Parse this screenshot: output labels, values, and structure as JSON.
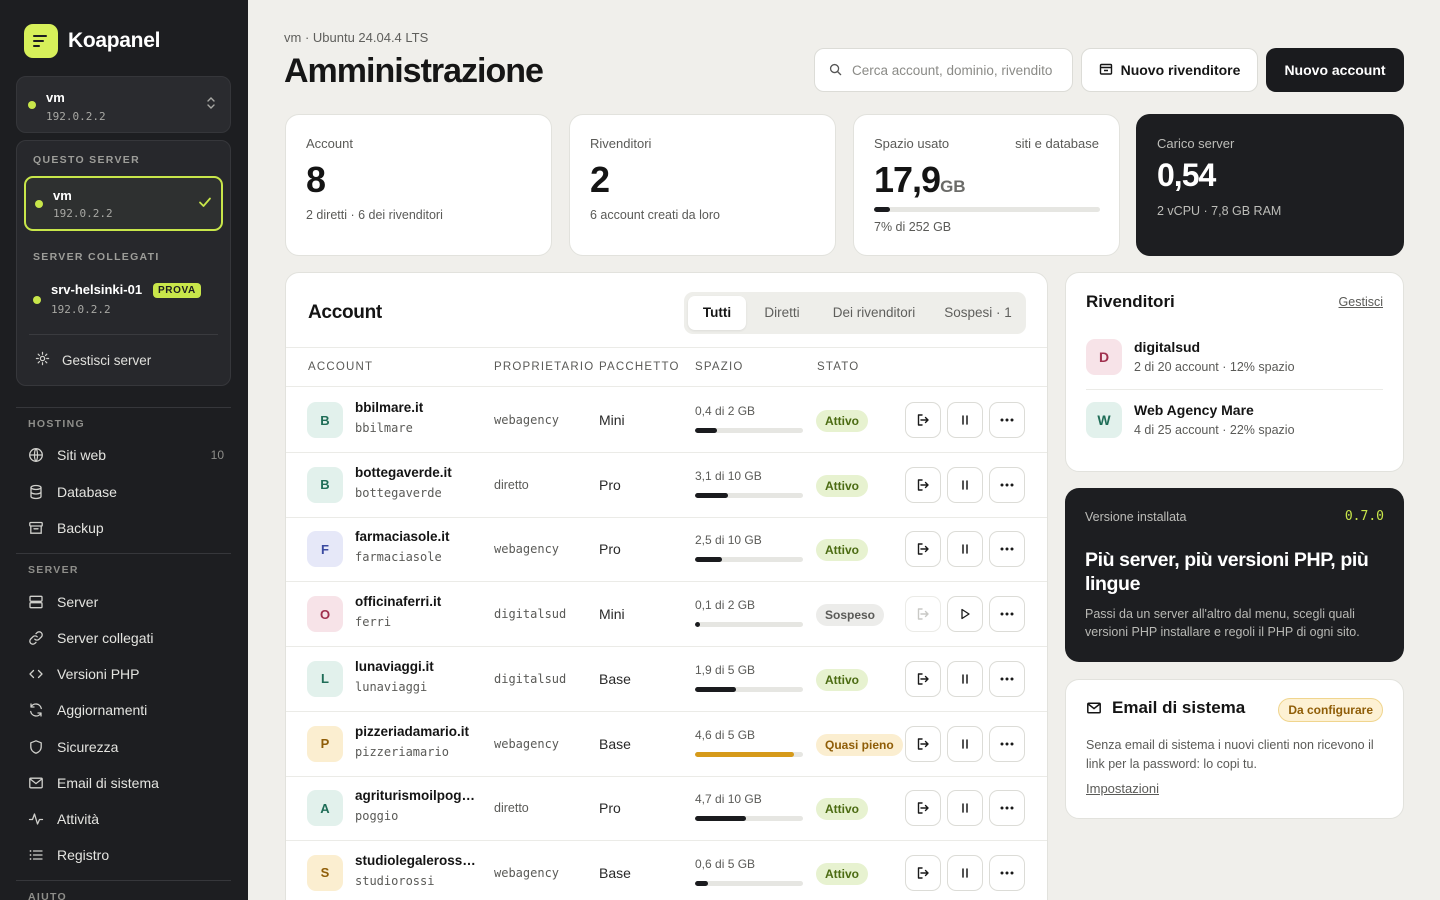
{
  "brand": {
    "name": "Koapanel",
    "accent": "#c8e64a"
  },
  "server_switcher": {
    "name": "vm",
    "ip": "192.0.2.2"
  },
  "dropdown": {
    "this_server_title": "QUESTO SERVER",
    "current": {
      "name": "vm",
      "ip": "192.0.2.2"
    },
    "linked_title": "SERVER COLLEGATI",
    "linked": {
      "name": "srv-helsinki-01",
      "badge": "PROVA",
      "ip": "192.0.2.2"
    },
    "manage_label": "Gestisci server"
  },
  "nav": {
    "hosting_title": "HOSTING",
    "hosting": [
      {
        "label": "Siti web",
        "count": "10",
        "icon": "globe-icon"
      },
      {
        "label": "Database",
        "icon": "database-icon"
      },
      {
        "label": "Backup",
        "icon": "archive-icon"
      }
    ],
    "server_title": "SERVER",
    "server": [
      {
        "label": "Server",
        "icon": "server-icon"
      },
      {
        "label": "Server collegati",
        "icon": "link-icon"
      },
      {
        "label": "Versioni PHP",
        "icon": "code-icon"
      },
      {
        "label": "Aggiornamenti",
        "icon": "refresh-icon"
      },
      {
        "label": "Sicurezza",
        "icon": "shield-icon"
      },
      {
        "label": "Email di sistema",
        "icon": "mail-icon"
      },
      {
        "label": "Attività",
        "icon": "activity-icon"
      },
      {
        "label": "Registro",
        "icon": "list-icon"
      }
    ],
    "help_title": "AIUTO"
  },
  "header": {
    "subtitle": "vm · Ubuntu 24.04.4 LTS",
    "title": "Amministrazione",
    "search_placeholder": "Cerca account, dominio, rivenditore",
    "new_reseller": "Nuovo rivenditore",
    "new_account": "Nuovo account"
  },
  "stats": {
    "accounts": {
      "label": "Account",
      "value": "8",
      "note": "2 diretti · 6 dei rivenditori"
    },
    "resellers": {
      "label": "Rivenditori",
      "value": "2",
      "note": "6 account creati da loro"
    },
    "space": {
      "label": "Spazio usato",
      "right": "siti e database",
      "value": "17,9",
      "unit": "GB",
      "note": "7% di 252 GB",
      "fraction": 0.07
    },
    "load": {
      "label": "Carico server",
      "value": "0,54",
      "note": "2 vCPU · 7,8 GB RAM"
    }
  },
  "accounts": {
    "title": "Account",
    "tabs": [
      "Tutti",
      "Diretti",
      "Dei rivenditori",
      "Sospesi · 1"
    ],
    "columns": [
      "ACCOUNT",
      "PROPRIETARIO",
      "PACCHETTO",
      "SPAZIO",
      "STATO"
    ],
    "rows": [
      {
        "initial": "B",
        "domain": "bbilmare.it",
        "user": "bbilmare",
        "owner": "webagency",
        "package": "Mini",
        "space": "0,4 di 2 GB",
        "fraction": 0.2,
        "status": "Attivo"
      },
      {
        "initial": "B",
        "domain": "bottegaverde.it",
        "user": "bottegaverde",
        "owner": "diretto",
        "package": "Pro",
        "space": "3,1 di 10 GB",
        "fraction": 0.31,
        "status": "Attivo"
      },
      {
        "initial": "F",
        "domain": "farmaciasole.it",
        "user": "farmaciasole",
        "owner": "webagency",
        "package": "Pro",
        "space": "2,5 di 10 GB",
        "fraction": 0.25,
        "status": "Attivo"
      },
      {
        "initial": "O",
        "domain": "officinaferri.it",
        "user": "ferri",
        "owner": "digitalsud",
        "package": "Mini",
        "space": "0,1 di 2 GB",
        "fraction": 0.05,
        "status": "Sospeso"
      },
      {
        "initial": "L",
        "domain": "lunaviaggi.it",
        "user": "lunaviaggi",
        "owner": "digitalsud",
        "package": "Base",
        "space": "1,9 di 5 GB",
        "fraction": 0.38,
        "status": "Attivo"
      },
      {
        "initial": "P",
        "domain": "pizzeriadamario.it",
        "user": "pizzeriamario",
        "owner": "webagency",
        "package": "Base",
        "space": "4,6 di 5 GB",
        "fraction": 0.92,
        "status": "Quasi pieno"
      },
      {
        "initial": "A",
        "domain": "agriturismoilpoggio.it",
        "user": "poggio",
        "owner": "diretto",
        "package": "Pro",
        "space": "4,7 di 10 GB",
        "fraction": 0.47,
        "status": "Attivo"
      },
      {
        "initial": "S",
        "domain": "studiolegalerossi.it",
        "user": "studiorossi",
        "owner": "webagency",
        "package": "Base",
        "space": "0,6 di 5 GB",
        "fraction": 0.12,
        "status": "Attivo"
      }
    ]
  },
  "resellers_card": {
    "title": "Rivenditori",
    "manage": "Gestisci",
    "items": [
      {
        "initial": "D",
        "name": "digitalsud",
        "sub": "2 di 20 account · 12% spazio"
      },
      {
        "initial": "W",
        "name": "Web Agency Mare",
        "sub": "4 di 25 account · 22% spazio"
      }
    ]
  },
  "version_card": {
    "label": "Versione installata",
    "version": "0.7.0",
    "title": "Più server, più versioni PHP, più lingue",
    "desc": "Passi da un server all'altro dal menu, scegli quali versioni PHP installare e regoli il PHP di ogni sito."
  },
  "email_card": {
    "title": "Email di sistema",
    "badge": "Da configurare",
    "desc": "Senza email di sistema i nuovi clienti non ricevono il link per la password: lo copi tu.",
    "link": "Impostazioni"
  }
}
